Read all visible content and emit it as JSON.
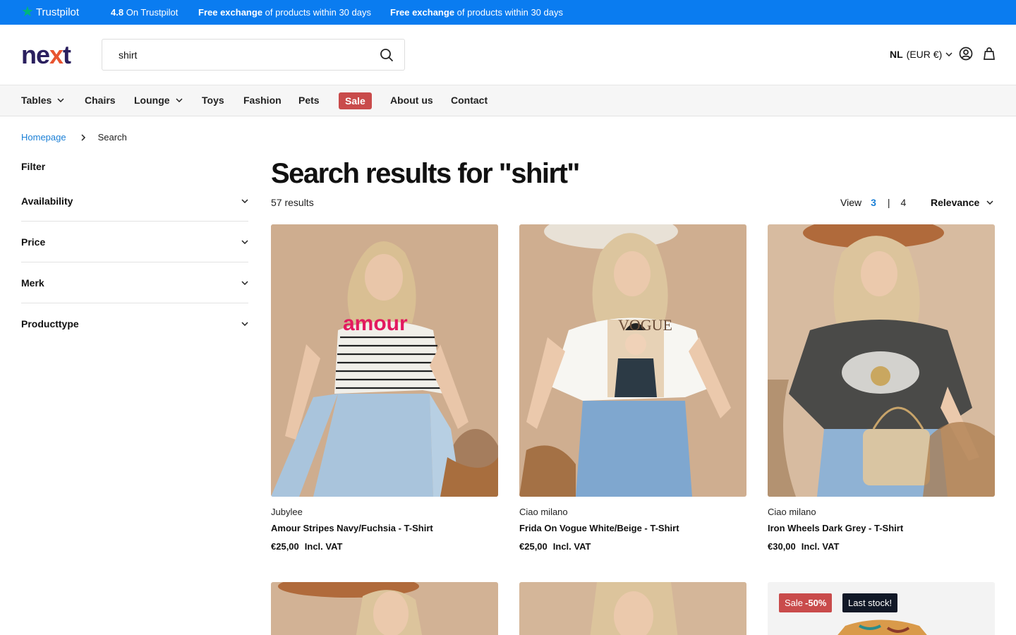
{
  "topbar": {
    "trustpilot_label": "Trustpilot",
    "rating_value": "4.8",
    "rating_text": "On Trustpilot",
    "promos": [
      {
        "bold": "Free exchange",
        "text": "of products within 30 days"
      },
      {
        "bold": "Free exchange",
        "text": "of products within 30 days"
      }
    ]
  },
  "header": {
    "logo_pre": "ne",
    "logo_x": "x",
    "logo_post": "t",
    "search_value": "shirt",
    "region": "NL",
    "currency": "(EUR €)"
  },
  "nav": {
    "items": [
      {
        "label": "Tables",
        "dropdown": true
      },
      {
        "label": "Chairs",
        "dropdown": false
      },
      {
        "label": "Lounge",
        "dropdown": true
      },
      {
        "label": "Toys",
        "dropdown": false
      },
      {
        "label": "Fashion",
        "dropdown": false
      },
      {
        "label": "Pets",
        "dropdown": false
      },
      {
        "label": "Sale",
        "dropdown": false
      },
      {
        "label": "About us",
        "dropdown": false
      },
      {
        "label": "Contact",
        "dropdown": false
      }
    ]
  },
  "breadcrumb": {
    "home": "Homepage",
    "current": "Search"
  },
  "filters": {
    "title": "Filter",
    "groups": [
      "Availability",
      "Price",
      "Merk",
      "Producttype"
    ]
  },
  "results": {
    "title": "Search results for \"shirt\"",
    "count": "57 results",
    "view_label": "View",
    "view_options": [
      "3",
      "4"
    ],
    "view_selected": "3",
    "sort_label": "Relevance"
  },
  "products": [
    {
      "brand": "Jubylee",
      "name": "Amour Stripes Navy/Fuchsia - T-Shirt",
      "price": "€25,00",
      "vat": "Incl. VAT"
    },
    {
      "brand": "Ciao milano",
      "name": "Frida On Vogue White/Beige - T-Shirt",
      "price": "€25,00",
      "vat": "Incl. VAT"
    },
    {
      "brand": "Ciao milano",
      "name": "Iron Wheels Dark Grey - T-Shirt",
      "price": "€30,00",
      "vat": "Incl. VAT"
    }
  ],
  "badges": {
    "sale_label": "Sale",
    "sale_discount": "-50%",
    "last_stock": "Last stock!"
  },
  "colors": {
    "topbar": "#0a7cf0",
    "accent_link": "#1a7fd6",
    "sale_red": "#c94b4b",
    "logo_navy": "#2a1f5e",
    "logo_orange": "#e8542f"
  }
}
